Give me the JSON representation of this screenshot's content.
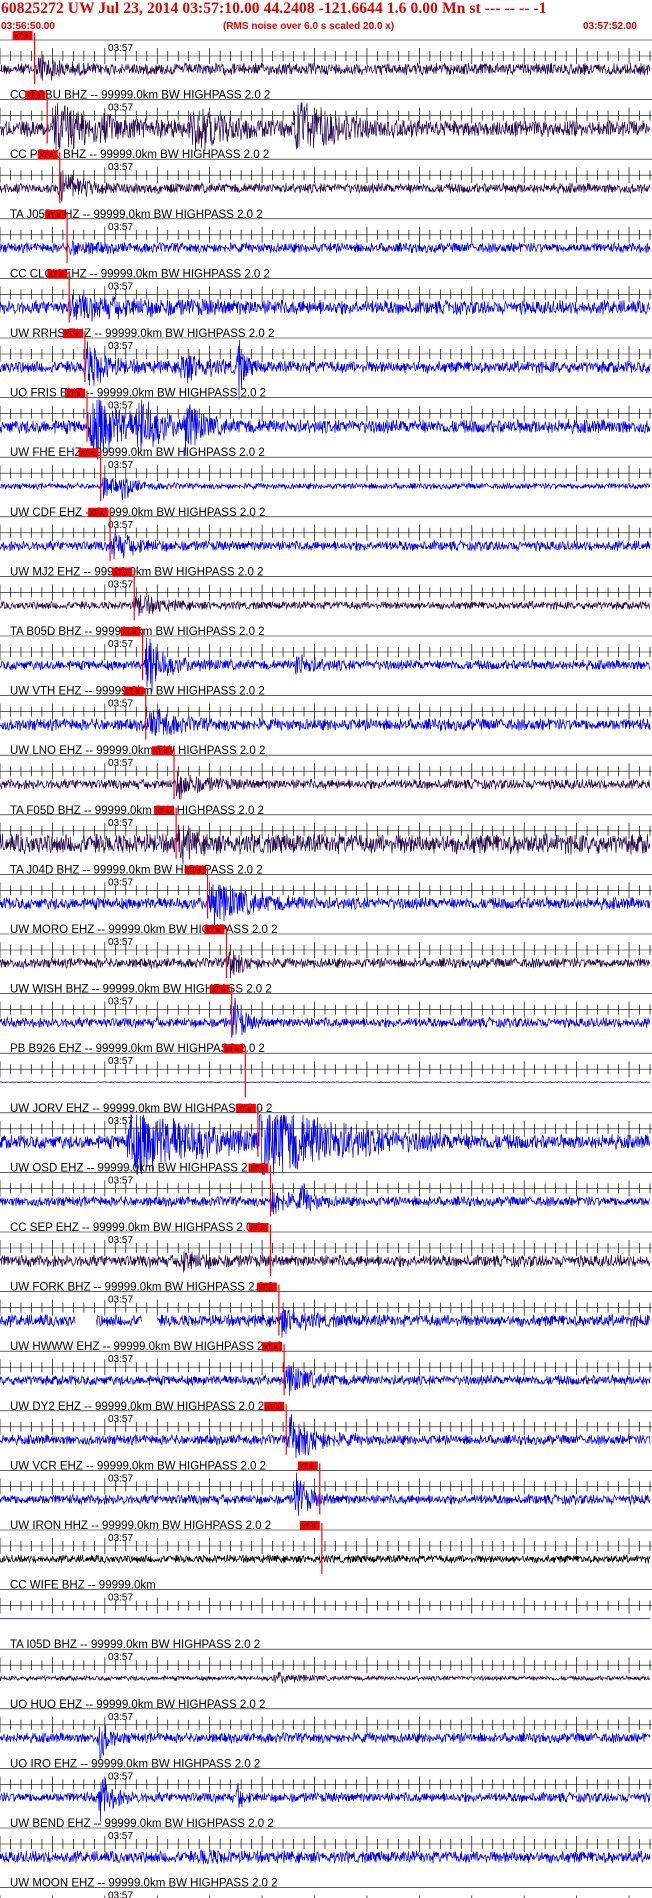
{
  "header": {
    "title": "60825272 UW Jul 23, 2014 03:57:10.00   44.2408 -121.6644  1.6 0.00 Mn st --- -- --  -1",
    "start_time": "03:56:50.00",
    "rms_note": "(RMS noise over 6.0 s scaled 20.0 x)",
    "end_time": "03:57:52.00"
  },
  "colors": {
    "header_red": "#e00000",
    "pick_red": "#ff0000",
    "trace_blue": "#0000ee",
    "trace_purple": "#2a0a55",
    "trace_black": "#000000"
  },
  "chart_data": {
    "type": "line",
    "title": "60825272 UW Jul 23, 2014 03:57:10.00   44.2408 -121.6644  1.6 0.00 Mn st --- -- --  -1",
    "x_start": "03:56:50.00",
    "x_end": "03:57:52.00",
    "x_range_seconds": [
      0,
      62
    ],
    "tick_label": "03:57",
    "tick_interval_seconds": 1,
    "pick_label": "xT a",
    "series": [
      {
        "label": "CC TCBU BHZ -- 99999.0km BW  HIGHPASS  2.0  2",
        "color": "purple",
        "amp": 0.3,
        "pick": 3.3,
        "events": [
          [
            3.5,
            6,
            0.8,
            1.5
          ]
        ]
      },
      {
        "label": "CC PRLK BHZ -- 99999.0km BW  HIGHPASS  2.0  2",
        "color": "purple",
        "amp": 0.4,
        "pick": 4.5,
        "events": [
          [
            5,
            23,
            1.3,
            4
          ],
          [
            18,
            24,
            1.1,
            3
          ],
          [
            28,
            11,
            1.5,
            3
          ]
        ]
      },
      {
        "label": "TA J05D BHZ -- 99999.0km BW  HIGHPASS  2.0  2",
        "color": "purple",
        "amp": 0.25,
        "pick": 5.7,
        "events": [
          [
            5.5,
            8,
            0.8,
            2
          ]
        ]
      },
      {
        "label": "CC CLCV EHZ -- 99999.0km BW  HIGHPASS  2.0  2",
        "color": "blue",
        "amp": 0.25,
        "pick": 6.4,
        "events": [
          [
            6.5,
            5,
            0.3,
            2
          ]
        ]
      },
      {
        "label": "UW RRHS EHZ -- 99999.0km BW  HIGHPASS  2.0  2",
        "color": "blue",
        "amp": 0.35,
        "pick": 6.6,
        "events": [
          [
            6.5,
            30,
            0.4,
            8
          ]
        ]
      },
      {
        "label": "UO FRIS EHZ -- 99999.0km BW  HIGHPASS  2.0  2",
        "color": "blue",
        "amp": 0.3,
        "pick": 8.1,
        "events": [
          [
            8,
            1.5,
            2.2,
            0.6
          ],
          [
            8.8,
            6,
            0.6,
            2
          ],
          [
            17,
            10,
            0.8,
            2
          ],
          [
            22.5,
            1.0,
            2.4,
            0.5
          ]
        ]
      },
      {
        "label": "UW FHE EHZ -- 99999.0km BW  HIGHPASS  2.0  2",
        "color": "blue",
        "amp": 0.35,
        "pick": 8.3,
        "events": [
          [
            8.3,
            2,
            2.0,
            0.8
          ],
          [
            9,
            14,
            1.4,
            3
          ],
          [
            13,
            4,
            1.6,
            1.5
          ],
          [
            17.5,
            3,
            1.5,
            1.2
          ]
        ]
      },
      {
        "label": "UW CDF EHZ -- 99999.0km BW  HIGHPASS  2.0  2",
        "color": "blue",
        "amp": 0.15,
        "pick": 9.6,
        "events": [
          [
            9.6,
            4,
            0.6,
            1.5
          ],
          [
            11.5,
            2,
            0.6,
            1
          ]
        ]
      },
      {
        "label": "UW MJ2 EHZ -- 99999.0km BW  HIGHPASS  2.0  2",
        "color": "blue",
        "amp": 0.25,
        "pick": 10.5,
        "events": [
          [
            10.5,
            6,
            0.7,
            2
          ]
        ]
      },
      {
        "label": "TA B05D BHZ -- 99999.0km BW  HIGHPASS  2.0  2",
        "color": "purple",
        "amp": 0.2,
        "pick": 12.8,
        "events": [
          [
            12.8,
            5,
            0.6,
            2
          ]
        ]
      },
      {
        "label": "UW VTH EHZ -- 99999.0km BW  HIGHPASS  2.0  2",
        "color": "blue",
        "amp": 0.25,
        "pick": 13.6,
        "events": [
          [
            13.8,
            1.5,
            2.8,
            0.5
          ],
          [
            14.2,
            6,
            0.8,
            2
          ],
          [
            28,
            4,
            0.6,
            1.5
          ]
        ]
      },
      {
        "label": "UW LNO EHZ -- 99999.0km BW  HIGHPASS  2.0  2",
        "color": "blue",
        "amp": 0.3,
        "pick": 13.9,
        "events": [
          [
            14,
            2,
            0.8,
            0.7
          ],
          [
            14.6,
            5,
            0.6,
            2
          ]
        ]
      },
      {
        "label": "TA F05D BHZ -- 99999.0km BW  HIGHPASS  2.0  2",
        "color": "purple",
        "amp": 0.25,
        "pick": 16.6,
        "events": [
          [
            16.6,
            6,
            0.7,
            2
          ]
        ]
      },
      {
        "label": "TA J04D BHZ -- 99999.0km BW  HIGHPASS  2.0  2",
        "color": "purple",
        "amp": 0.5,
        "pick": 16.8,
        "events": [
          [
            16.8,
            3,
            1.0,
            1
          ]
        ]
      },
      {
        "label": "UW MORO EHZ -- 99999.0km BW  HIGHPASS  2.0  2",
        "color": "blue",
        "amp": 0.3,
        "pick": 19.8,
        "events": [
          [
            19.8,
            12,
            1.2,
            3
          ]
        ]
      },
      {
        "label": "UW WISH BHZ -- 99999.0km BW  HIGHPASS  2.0  2",
        "color": "purple",
        "amp": 0.25,
        "pick": 21.6,
        "events": [
          [
            21.6,
            3,
            1.1,
            1
          ]
        ]
      },
      {
        "label": "PB B926 EHZ -- 99999.0km BW  HIGHPASS  2.0  2",
        "color": "blue",
        "amp": 0.25,
        "pick": 22.1,
        "events": [
          [
            22.1,
            2,
            1.6,
            0.8
          ]
        ]
      },
      {
        "label": "UW JORV EHZ -- 99999.0km BW  HIGHPASS  2.0  2",
        "color": "blue",
        "amp": 0.02,
        "pick": 23.4,
        "events": []
      },
      {
        "label": "UW OSD EHZ -- 99999.0km BW  HIGHPASS  2.0  2",
        "color": "blue",
        "amp": 0.35,
        "pick": 24.6,
        "events": [
          [
            12,
            30,
            1.9,
            6
          ],
          [
            24.6,
            20,
            2.2,
            6
          ]
        ]
      },
      {
        "label": "CC SEP EHZ -- 99999.0km BW  HIGHPASS  2.0  2",
        "color": "blue",
        "amp": 0.25,
        "pick": 25.8,
        "events": [
          [
            25.8,
            4,
            0.7,
            1.5
          ],
          [
            28.5,
            2,
            0.8,
            1
          ]
        ]
      },
      {
        "label": "UW FORK BHZ -- 99999.0km BW  HIGHPASS  2.0  2",
        "color": "purple",
        "amp": 0.3,
        "pick": 25.8,
        "events": [
          [
            17,
            3,
            0.5,
            2
          ]
        ]
      },
      {
        "label": "UW HWWW EHZ -- 99999.0km BW  HIGHPASS  2.0  2",
        "color": "blue",
        "amp": 0.3,
        "pick": 26.6,
        "events": [
          [
            26.6,
            4,
            0.6,
            2
          ]
        ],
        "gaps": [
          [
            7.2,
            9.2
          ],
          [
            13.5,
            15
          ]
        ]
      },
      {
        "label": "UW DY2 EHZ -- 99999.0km BW  HIGHPASS  2.0  2",
        "color": "blue",
        "amp": 0.25,
        "pick": 27.1,
        "events": [
          [
            27.1,
            5,
            0.8,
            2
          ]
        ]
      },
      {
        "label": "UW VCR EHZ -- 99999.0km BW  HIGHPASS  2.0  2",
        "color": "blue",
        "amp": 0.25,
        "pick": 27.3,
        "events": [
          [
            27.4,
            6,
            1.4,
            2
          ]
        ]
      },
      {
        "label": "UW IRON HHZ -- 99999.0km BW  HIGHPASS  2.0  2",
        "color": "blue",
        "amp": 0.25,
        "pick": 30.5,
        "events": [
          [
            28,
            3,
            1.5,
            1
          ]
        ]
      },
      {
        "label": "CC WIFE BHZ -- 99999.0km",
        "color": "black",
        "amp": 0.2,
        "pick": 30.7,
        "events": []
      },
      {
        "label": "TA I05D BHZ -- 99999.0km BW  HIGHPASS  2.0  2",
        "color": "blue",
        "amp": 0.0,
        "pick": null,
        "events": [],
        "flat": true
      },
      {
        "label": "UO HUO EHZ -- 99999.0km BW  HIGHPASS  2.0  2",
        "color": "purple",
        "amp": 0.12,
        "pick": null,
        "events": [
          [
            26,
            5,
            0.3,
            2
          ]
        ]
      },
      {
        "label": "UO IRO EHZ -- 99999.0km BW  HIGHPASS  2.0  2",
        "color": "blue",
        "amp": 0.25,
        "pick": null,
        "events": [
          [
            9.3,
            2,
            1.5,
            0.7
          ]
        ]
      },
      {
        "label": "UW BEND EHZ -- 99999.0km BW  HIGHPASS  2.0  2",
        "color": "blue",
        "amp": 0.25,
        "pick": null,
        "events": [
          [
            9.3,
            3,
            1.5,
            1
          ],
          [
            22.5,
            1,
            0.8,
            0.5
          ]
        ]
      },
      {
        "label": "UW MOON EHZ -- 99999.0km BW  HIGHPASS  2.0  2",
        "color": "blue",
        "amp": 0.3,
        "pick": null,
        "events": [
          [
            19,
            3,
            0.3,
            1.5
          ]
        ]
      },
      {
        "label": "",
        "color": "blue",
        "amp": 0.25,
        "pick": null,
        "events": []
      }
    ]
  }
}
